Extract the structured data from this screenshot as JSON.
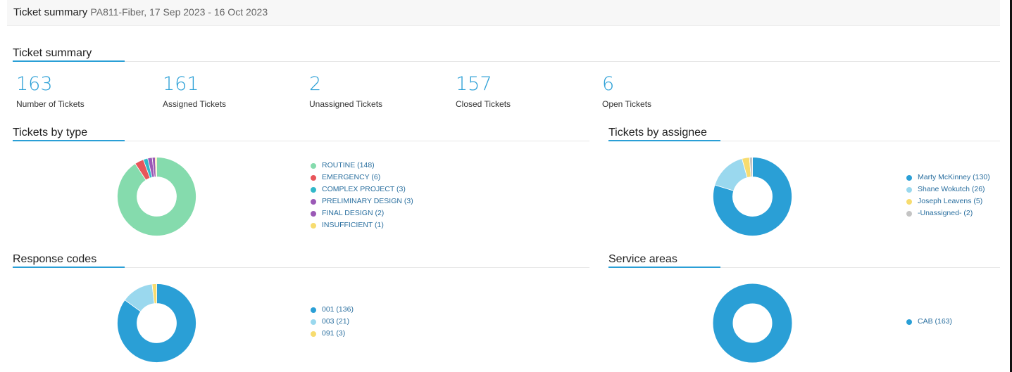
{
  "header": {
    "title": "Ticket summary",
    "subtitle": "PA811-Fiber, 17 Sep 2023 - 16 Oct 2023"
  },
  "summary": {
    "title": "Ticket summary",
    "stats": [
      {
        "value": "163",
        "label": "Number of Tickets"
      },
      {
        "value": "161",
        "label": "Assigned Tickets"
      },
      {
        "value": "2",
        "label": "Unassigned Tickets"
      },
      {
        "value": "157",
        "label": "Closed Tickets"
      },
      {
        "value": "6",
        "label": "Open Tickets"
      }
    ]
  },
  "sections": {
    "by_type": {
      "title": "Tickets by type"
    },
    "by_assignee": {
      "title": "Tickets by assignee"
    },
    "response_codes": {
      "title": "Response codes"
    },
    "service_areas": {
      "title": "Service areas"
    }
  },
  "accent_color": "#2a9fd6",
  "chart_data": [
    {
      "id": "type",
      "type": "pie",
      "categories": [
        "ROUTINE",
        "EMERGENCY",
        "COMPLEX PROJECT",
        "PRELIMINARY DESIGN",
        "FINAL DESIGN",
        "INSUFFICIENT"
      ],
      "values": [
        148,
        6,
        3,
        3,
        2,
        1
      ],
      "colors": [
        "#85dbad",
        "#e8555a",
        "#31b8c9",
        "#9b59b6",
        "#9b59b6",
        "#f7dc6f"
      ],
      "legend": [
        "ROUTINE (148)",
        "EMERGENCY (6)",
        "COMPLEX PROJECT (3)",
        "PRELIMINARY DESIGN (3)",
        "FINAL DESIGN (2)",
        "INSUFFICIENT (1)"
      ]
    },
    {
      "id": "assignee",
      "type": "pie",
      "categories": [
        "Marty McKinney",
        "Shane Wokutch",
        "Joseph Leavens",
        "-Unassigned-"
      ],
      "values": [
        130,
        26,
        5,
        2
      ],
      "colors": [
        "#2a9fd6",
        "#9ad8ee",
        "#f7dc6f",
        "#c4c4c4"
      ],
      "legend": [
        "Marty McKinney (130)",
        "Shane Wokutch (26)",
        "Joseph Leavens (5)",
        "-Unassigned- (2)"
      ]
    },
    {
      "id": "response",
      "type": "pie",
      "categories": [
        "001",
        "003",
        "091"
      ],
      "values": [
        136,
        21,
        3
      ],
      "colors": [
        "#2a9fd6",
        "#9ad8ee",
        "#f7dc6f"
      ],
      "legend": [
        "001 (136)",
        "003 (21)",
        "091 (3)"
      ]
    },
    {
      "id": "service",
      "type": "pie",
      "categories": [
        "CAB"
      ],
      "values": [
        163
      ],
      "colors": [
        "#2a9fd6"
      ],
      "legend": [
        "CAB (163)"
      ]
    }
  ]
}
